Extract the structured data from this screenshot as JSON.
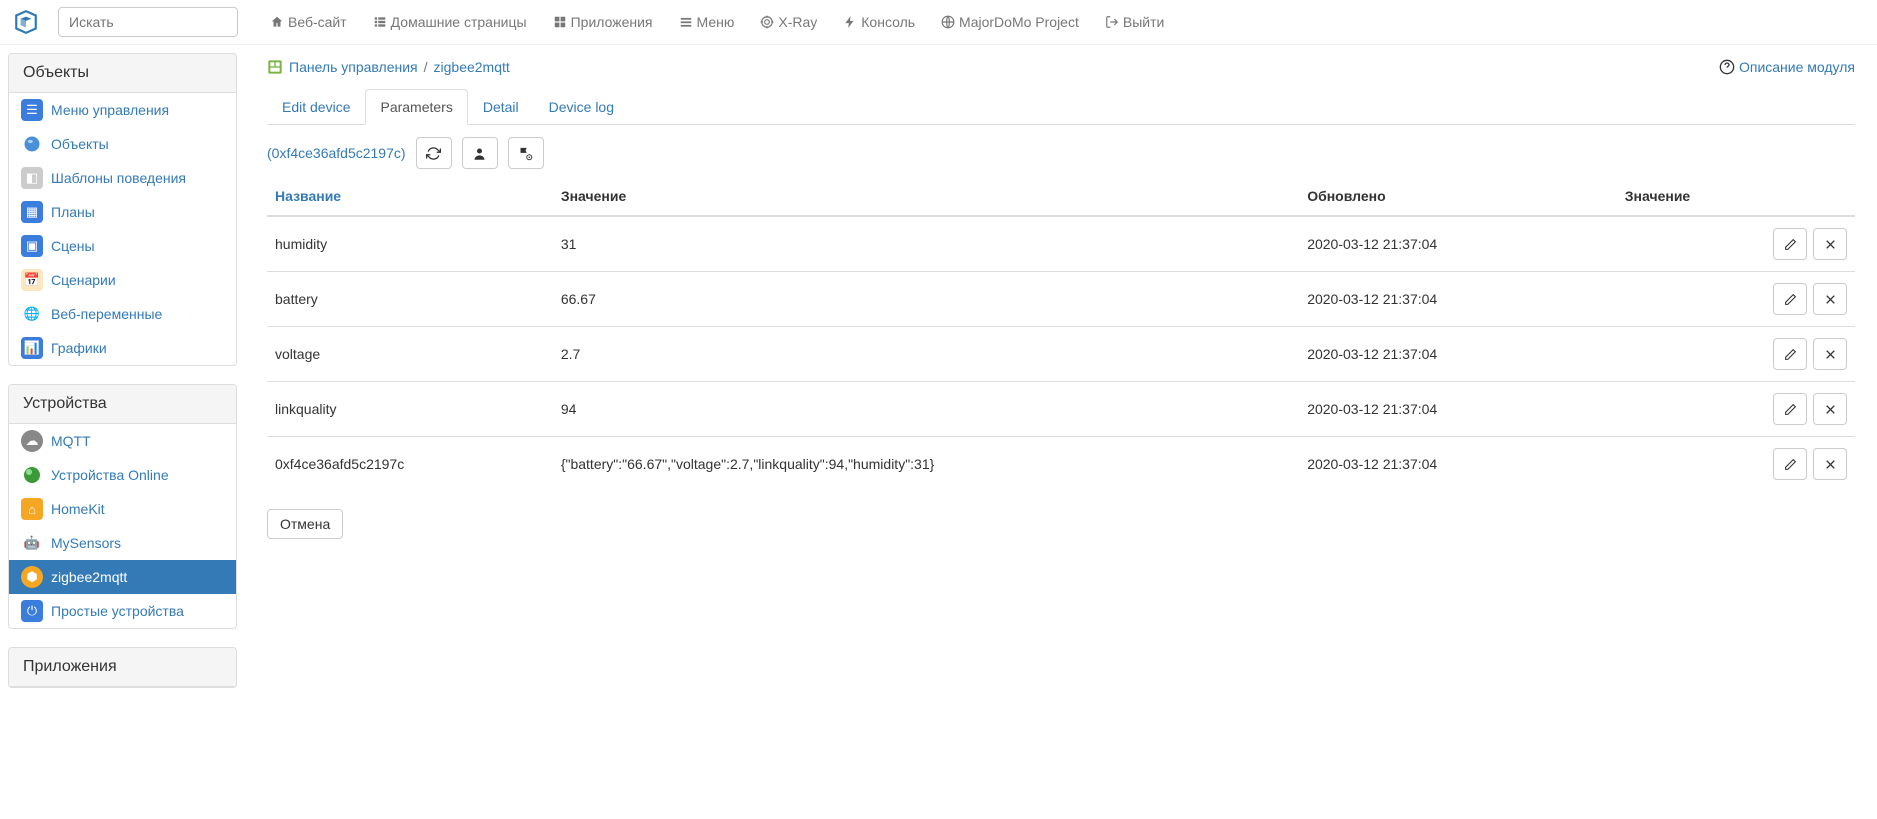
{
  "search": {
    "placeholder": "Искать"
  },
  "topnav": {
    "website": "Веб-сайт",
    "homepages": "Домашние страницы",
    "apps": "Приложения",
    "menu": "Меню",
    "xray": "X-Ray",
    "console": "Консоль",
    "project": "MajorDoMo Project",
    "logout": "Выйти"
  },
  "sidebar": {
    "objects_header": "Объекты",
    "devices_header": "Устройства",
    "apps_header": "Приложения",
    "objects_items": [
      {
        "label": "Меню управления"
      },
      {
        "label": "Объекты"
      },
      {
        "label": "Шаблоны поведения"
      },
      {
        "label": "Планы"
      },
      {
        "label": "Сцены"
      },
      {
        "label": "Сценарии"
      },
      {
        "label": "Веб-переменные"
      },
      {
        "label": "Графики"
      }
    ],
    "devices_items": [
      {
        "label": "MQTT"
      },
      {
        "label": "Устройства Online"
      },
      {
        "label": "HomeKit"
      },
      {
        "label": "MySensors"
      },
      {
        "label": "zigbee2mqtt"
      },
      {
        "label": "Простые устройства"
      }
    ]
  },
  "breadcrumb": {
    "control_panel": "Панель управления",
    "current": "zigbee2mqtt"
  },
  "help_link": "Описание модуля",
  "tabs": {
    "edit_device": "Edit device",
    "parameters": "Parameters",
    "detail": "Detail",
    "device_log": "Device log"
  },
  "device_id": "(0xf4ce36afd5c2197c)",
  "table": {
    "headers": {
      "name": "Название",
      "value": "Значение",
      "updated": "Обновлено",
      "actions": "Значение"
    },
    "rows": [
      {
        "name": "humidity",
        "value": "31",
        "updated": "2020-03-12 21:37:04"
      },
      {
        "name": "battery",
        "value": "66.67",
        "updated": "2020-03-12 21:37:04"
      },
      {
        "name": "voltage",
        "value": "2.7",
        "updated": "2020-03-12 21:37:04"
      },
      {
        "name": "linkquality",
        "value": "94",
        "updated": "2020-03-12 21:37:04"
      },
      {
        "name": "0xf4ce36afd5c2197c",
        "value": "{\"battery\":\"66.67\",\"voltage\":2.7,\"linkquality\":94,\"humidity\":31}",
        "updated": "2020-03-12 21:37:04"
      }
    ]
  },
  "cancel_label": "Отмена"
}
